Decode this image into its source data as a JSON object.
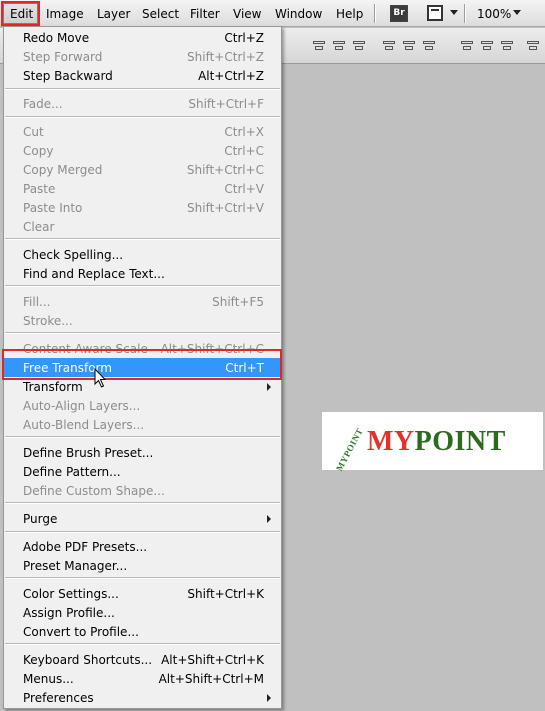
{
  "menubar": {
    "items": [
      "Edit",
      "Image",
      "Layer",
      "Select",
      "Filter",
      "View",
      "Window",
      "Help"
    ],
    "bridge_label": "Br",
    "zoom": "100%"
  },
  "edit_menu": {
    "items": [
      {
        "label": "Redo Move",
        "shortcut": "Ctrl+Z"
      },
      {
        "label": "Step Forward",
        "shortcut": "Shift+Ctrl+Z"
      },
      {
        "label": "Step Backward",
        "shortcut": "Alt+Ctrl+Z"
      },
      {
        "label": "Fade...",
        "shortcut": "Shift+Ctrl+F"
      },
      {
        "label": "Cut",
        "shortcut": "Ctrl+X"
      },
      {
        "label": "Copy",
        "shortcut": "Ctrl+C"
      },
      {
        "label": "Copy Merged",
        "shortcut": "Shift+Ctrl+C"
      },
      {
        "label": "Paste",
        "shortcut": "Ctrl+V"
      },
      {
        "label": "Paste Into",
        "shortcut": "Shift+Ctrl+V"
      },
      {
        "label": "Clear",
        "shortcut": ""
      },
      {
        "label": "Check Spelling...",
        "shortcut": ""
      },
      {
        "label": "Find and Replace Text...",
        "shortcut": ""
      },
      {
        "label": "Fill...",
        "shortcut": "Shift+F5"
      },
      {
        "label": "Stroke...",
        "shortcut": ""
      },
      {
        "label": "Content-Aware Scale",
        "shortcut": "Alt+Shift+Ctrl+C"
      },
      {
        "label": "Free Transform",
        "shortcut": "Ctrl+T"
      },
      {
        "label": "Transform",
        "shortcut": ""
      },
      {
        "label": "Auto-Align Layers...",
        "shortcut": ""
      },
      {
        "label": "Auto-Blend Layers...",
        "shortcut": ""
      },
      {
        "label": "Define Brush Preset...",
        "shortcut": ""
      },
      {
        "label": "Define Pattern...",
        "shortcut": ""
      },
      {
        "label": "Define Custom Shape...",
        "shortcut": ""
      },
      {
        "label": "Purge",
        "shortcut": ""
      },
      {
        "label": "Adobe PDF Presets...",
        "shortcut": ""
      },
      {
        "label": "Preset Manager...",
        "shortcut": ""
      },
      {
        "label": "Color Settings...",
        "shortcut": "Shift+Ctrl+K"
      },
      {
        "label": "Assign Profile...",
        "shortcut": ""
      },
      {
        "label": "Convert to Profile...",
        "shortcut": ""
      },
      {
        "label": "Keyboard Shortcuts...",
        "shortcut": "Alt+Shift+Ctrl+K"
      },
      {
        "label": "Menus...",
        "shortcut": "Alt+Shift+Ctrl+M"
      },
      {
        "label": "Preferences",
        "shortcut": ""
      }
    ]
  },
  "logo": {
    "arc_text": "MYPOINT",
    "my": "MY",
    "point": "POINT"
  },
  "colors": {
    "highlight": "#3397fa",
    "callout": "#e3262a",
    "canvas": "#c0c0c0"
  }
}
